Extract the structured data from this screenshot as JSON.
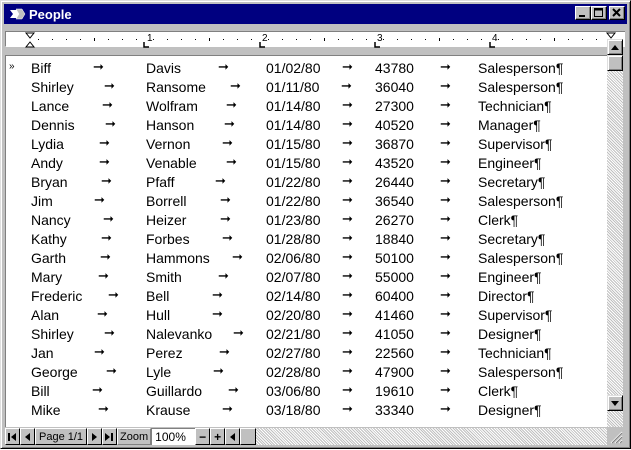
{
  "window": {
    "title": "People"
  },
  "ruler": {
    "numbers": [
      "1",
      "2",
      "3",
      "4"
    ]
  },
  "table": {
    "row_marker": "»",
    "arrow": "➞",
    "rows": [
      [
        "Biff",
        "Davis",
        "01/02/80",
        "43780",
        "Salesperson¶"
      ],
      [
        "Shirley",
        "Ransome",
        "01/11/80",
        "36040",
        "Salesperson¶"
      ],
      [
        "Lance",
        "Wolfram",
        "01/14/80",
        "27300",
        "Technician¶"
      ],
      [
        "Dennis",
        "Hanson",
        "01/14/80",
        "40520",
        "Manager¶"
      ],
      [
        "Lydia",
        "Vernon",
        "01/15/80",
        "36870",
        "Supervisor¶"
      ],
      [
        "Andy",
        "Venable",
        "01/15/80",
        "43520",
        "Engineer¶"
      ],
      [
        "Bryan",
        "Pfaff",
        "01/22/80",
        "26440",
        "Secretary¶"
      ],
      [
        "Jim",
        "Borrell",
        "01/22/80",
        "36540",
        "Salesperson¶"
      ],
      [
        "Nancy",
        "Heizer",
        "01/23/80",
        "26270",
        "Clerk¶"
      ],
      [
        "Kathy",
        "Forbes",
        "01/28/80",
        "18840",
        "Secretary¶"
      ],
      [
        "Garth",
        "Hammons",
        "02/06/80",
        "50100",
        "Salesperson¶"
      ],
      [
        "Mary",
        "Smith",
        "02/07/80",
        "55000",
        "Engineer¶"
      ],
      [
        "Frederic",
        "Bell",
        "02/14/80",
        "60400",
        "Director¶"
      ],
      [
        "Alan",
        "Hull",
        "02/20/80",
        "41460",
        "Supervisor¶"
      ],
      [
        "Shirley",
        "Nalevanko",
        "02/21/80",
        "41050",
        "Designer¶"
      ],
      [
        "Jan",
        "Perez",
        "02/27/80",
        "22560",
        "Technician¶"
      ],
      [
        "George",
        "Lyle",
        "02/28/80",
        "47900",
        "Salesperson¶"
      ],
      [
        "Bill",
        "Guillardo",
        "03/06/80",
        "19610",
        "Clerk¶"
      ],
      [
        "Mike",
        "Krause",
        "03/18/80",
        "33340",
        "Designer¶"
      ]
    ]
  },
  "statusbar": {
    "page_label": "Page 1/1",
    "zoom_label": "Zoom",
    "zoom_value": "100%",
    "zoom_minus": "−",
    "zoom_plus": "+"
  }
}
